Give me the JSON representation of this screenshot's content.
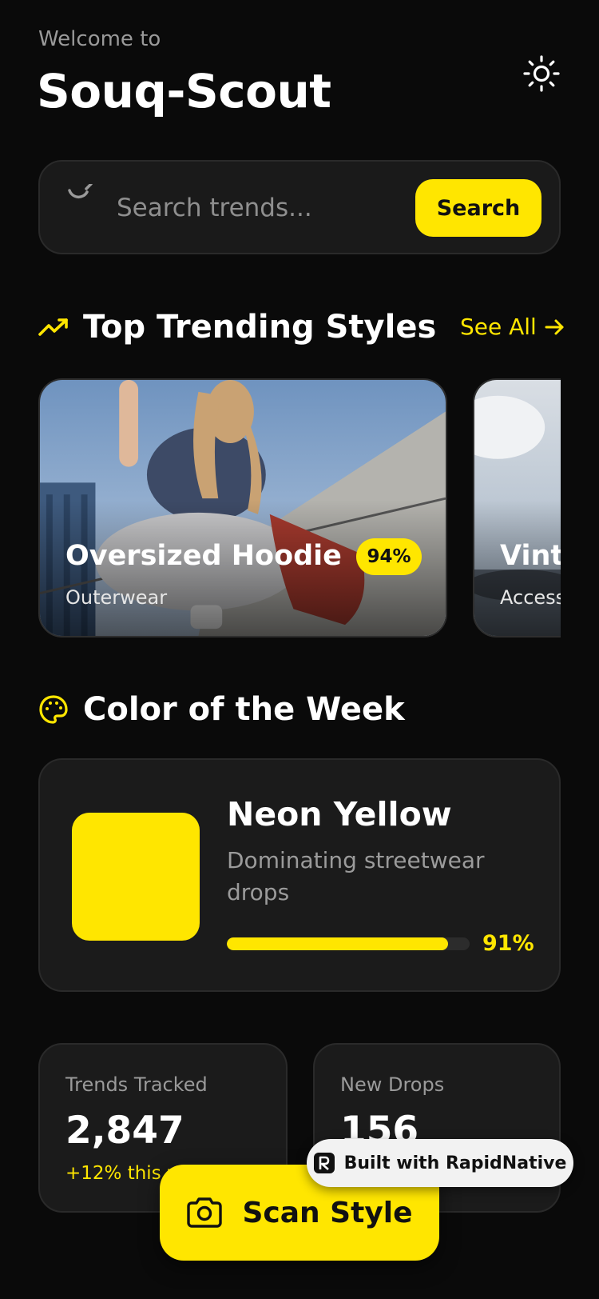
{
  "header": {
    "welcome": "Welcome to",
    "title": "Souq-Scout",
    "theme_icon": "sun-icon"
  },
  "search": {
    "placeholder": "Search trends...",
    "value": "",
    "button_label": "Search",
    "icon": "search-icon"
  },
  "trending": {
    "title": "Top Trending Styles",
    "icon": "trending-up-icon",
    "see_all": "See All",
    "cards": [
      {
        "name": "Oversized Hoodie",
        "category": "Outerwear",
        "score": "94%"
      },
      {
        "name": "Vint",
        "category": "Access"
      }
    ]
  },
  "color_week": {
    "title": "Color of the Week",
    "icon": "palette-icon",
    "color_name": "Neon Yellow",
    "description": "Dominating streetwear drops",
    "percent_label": "91%",
    "percent_value": 91,
    "swatch_color": "#FFE600"
  },
  "stats": [
    {
      "label": "Trends Tracked",
      "value": "2,847",
      "change": "+12% this w"
    },
    {
      "label": "New Drops",
      "value": "156"
    }
  ],
  "scan": {
    "label": "Scan Style",
    "icon": "camera-icon"
  },
  "badge": {
    "label": "Built with RapidNative"
  },
  "colors": {
    "accent": "#FFE600",
    "background": "#0A0A0A",
    "card": "#1B1B1B"
  }
}
